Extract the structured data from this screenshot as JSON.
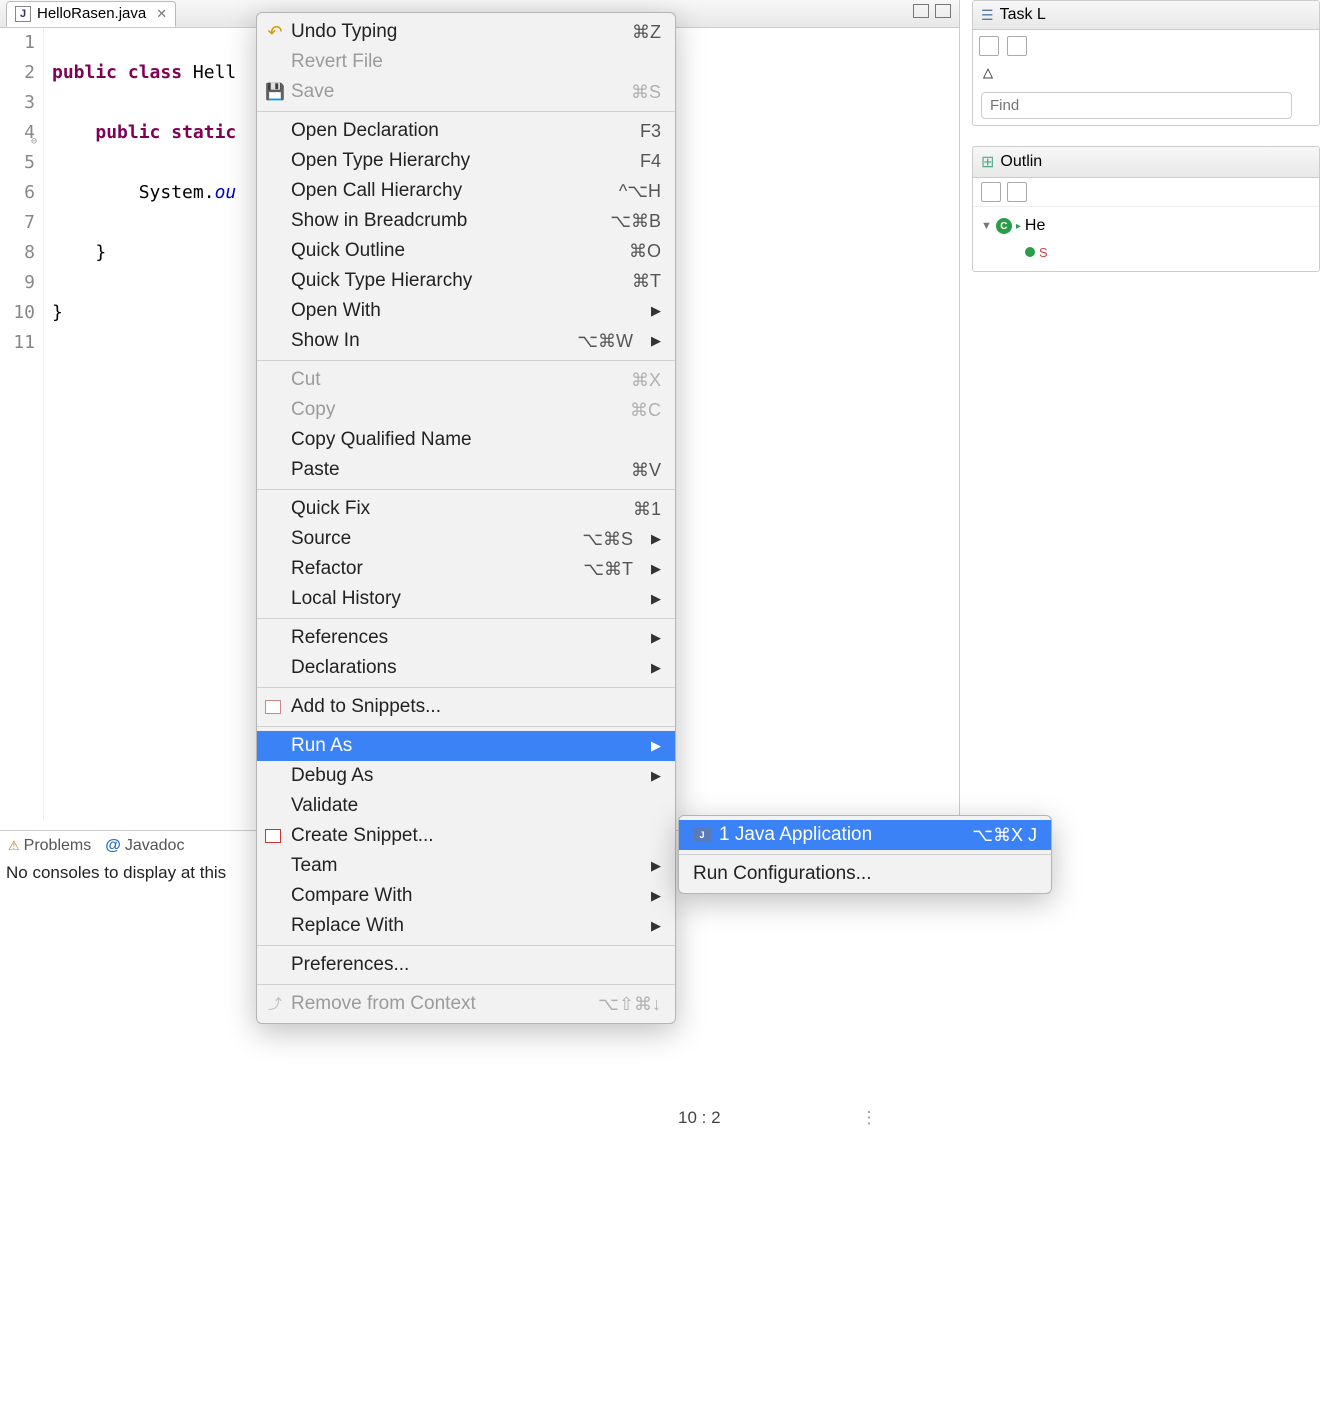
{
  "editor": {
    "tab": {
      "filename": "HelloRasen.java"
    },
    "lines": [
      "1",
      "2",
      "3",
      "4",
      "5",
      "6",
      "7",
      "8",
      "9",
      "10",
      "11"
    ],
    "code": {
      "l2_kw1": "public",
      "l2_kw2": "class",
      "l2_cls": "Hell",
      "l4_kw1": "public",
      "l4_kw2": "static",
      "l6_obj": "System.",
      "l6_fld": "ou",
      "l8": "    }",
      "l10": "}"
    },
    "highlight_line_index": 9
  },
  "context_menu": {
    "items": [
      {
        "label": "Undo Typing",
        "shortcut": "⌘Z",
        "icon": "undo"
      },
      {
        "label": "Revert File",
        "disabled": true
      },
      {
        "label": "Save",
        "shortcut": "⌘S",
        "disabled": true,
        "icon": "save"
      },
      {
        "sep": true
      },
      {
        "label": "Open Declaration",
        "shortcut": "F3"
      },
      {
        "label": "Open Type Hierarchy",
        "shortcut": "F4"
      },
      {
        "label": "Open Call Hierarchy",
        "shortcut": "^⌥H"
      },
      {
        "label": "Show in Breadcrumb",
        "shortcut": "⌥⌘B"
      },
      {
        "label": "Quick Outline",
        "shortcut": "⌘O"
      },
      {
        "label": "Quick Type Hierarchy",
        "shortcut": "⌘T"
      },
      {
        "label": "Open With",
        "submenu": true
      },
      {
        "label": "Show In",
        "shortcut": "⌥⌘W",
        "submenu": true
      },
      {
        "sep": true
      },
      {
        "label": "Cut",
        "shortcut": "⌘X",
        "disabled": true
      },
      {
        "label": "Copy",
        "shortcut": "⌘C",
        "disabled": true
      },
      {
        "label": "Copy Qualified Name"
      },
      {
        "label": "Paste",
        "shortcut": "⌘V"
      },
      {
        "sep": true
      },
      {
        "label": "Quick Fix",
        "shortcut": "⌘1"
      },
      {
        "label": "Source",
        "shortcut": "⌥⌘S",
        "submenu": true
      },
      {
        "label": "Refactor",
        "shortcut": "⌥⌘T",
        "submenu": true
      },
      {
        "label": "Local History",
        "submenu": true
      },
      {
        "sep": true
      },
      {
        "label": "References",
        "submenu": true
      },
      {
        "label": "Declarations",
        "submenu": true
      },
      {
        "sep": true
      },
      {
        "label": "Add to Snippets...",
        "icon": "snippet-add"
      },
      {
        "sep": true
      },
      {
        "label": "Run As",
        "submenu": true,
        "highlighted": true
      },
      {
        "label": "Debug As",
        "submenu": true
      },
      {
        "label": "Validate"
      },
      {
        "label": "Create Snippet...",
        "icon": "snippet-create"
      },
      {
        "label": "Team",
        "submenu": true
      },
      {
        "label": "Compare With",
        "submenu": true
      },
      {
        "label": "Replace With",
        "submenu": true
      },
      {
        "sep": true
      },
      {
        "label": "Preferences..."
      },
      {
        "sep": true
      },
      {
        "label": "Remove from Context",
        "shortcut": "⌥⇧⌘↓",
        "disabled": true,
        "icon": "remove-ctx"
      }
    ]
  },
  "submenu": {
    "item1_prefix": "1",
    "item1_label": "Java Application",
    "item1_shortcut": "⌥⌘X J",
    "item2_label": "Run Configurations..."
  },
  "bottom": {
    "tab_problems": "Problems",
    "tab_javadoc": "Javadoc",
    "console_message": "No consoles to display at this"
  },
  "sidebar": {
    "task_title": "Task L",
    "find_placeholder": "Find",
    "outline_title": "Outlin",
    "outline_class": "He",
    "outline_method": "S"
  },
  "status": {
    "cursor": "10 : 2"
  }
}
